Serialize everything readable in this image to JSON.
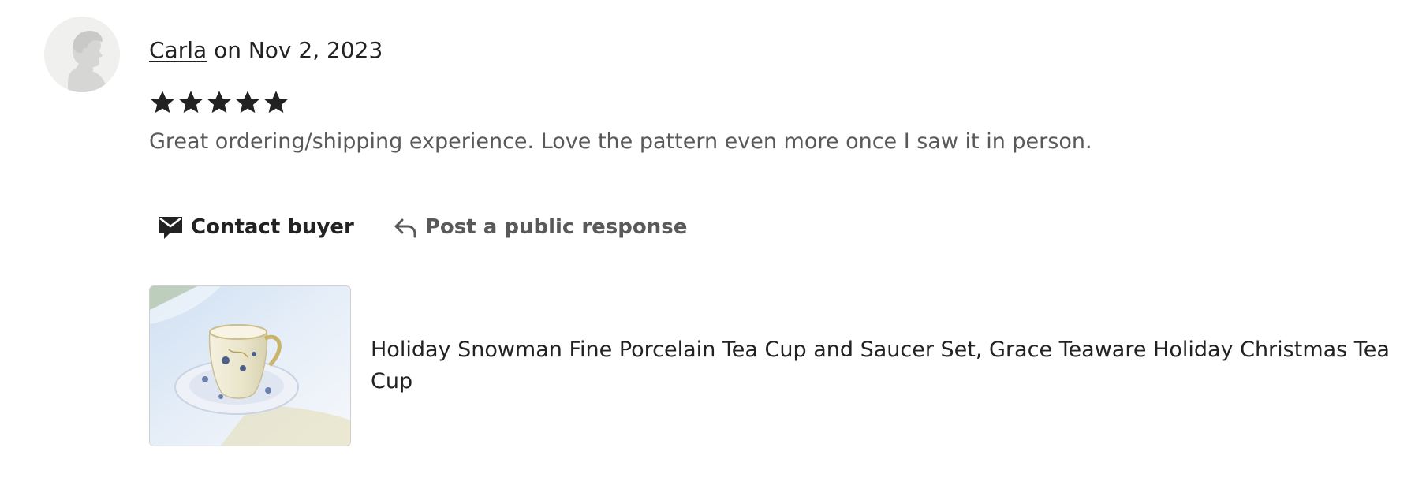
{
  "review": {
    "reviewer_name": "Carla",
    "date_text": "on Nov 2, 2023",
    "rating": 5,
    "rating_max": 5,
    "text": "Great ordering/shipping experience. Love the pattern even more once I saw it in person."
  },
  "actions": {
    "contact_label": "Contact buyer",
    "contact_icon": "envelope-icon",
    "respond_label": "Post a public response",
    "respond_icon": "reply-arrow-icon"
  },
  "listing": {
    "title": "Holiday Snowman Fine Porcelain Tea Cup and Saucer Set, Grace Teaware Holiday Christmas Tea Cup"
  },
  "colors": {
    "primary_text": "#222222",
    "secondary_text": "#595959",
    "avatar_bg": "#f0f0ee",
    "star": "#222222"
  }
}
